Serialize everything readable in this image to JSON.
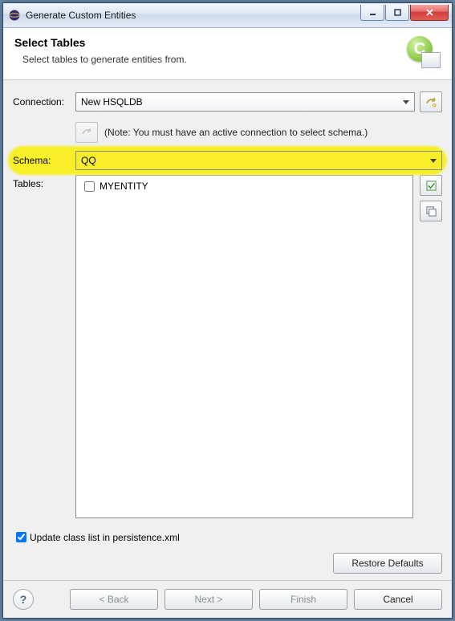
{
  "window": {
    "title": "Generate Custom Entities"
  },
  "banner": {
    "title": "Select Tables",
    "subtitle": "Select tables to generate entities from."
  },
  "form": {
    "connection_label": "Connection:",
    "connection_value": "New HSQLDB",
    "note": "(Note: You must have an active connection to select schema.)",
    "schema_label": "Schema:",
    "schema_value": "QQ",
    "tables_label": "Tables:",
    "tables": [
      {
        "name": "MYENTITY",
        "checked": false
      }
    ],
    "update_checkbox_label": "Update class list in persistence.xml",
    "update_checked": true
  },
  "buttons": {
    "restore": "Restore Defaults",
    "back": "< Back",
    "next": "Next >",
    "finish": "Finish",
    "cancel": "Cancel"
  },
  "icons": {
    "app": "eclipse-icon",
    "wizard": "entity-wizard-icon",
    "new_connection": "new-connection-icon",
    "reconnect": "reconnect-icon",
    "select_all": "select-all-icon",
    "deselect_all": "deselect-all-icon",
    "help": "?"
  },
  "colors": {
    "highlight": "#f8ef2a"
  }
}
